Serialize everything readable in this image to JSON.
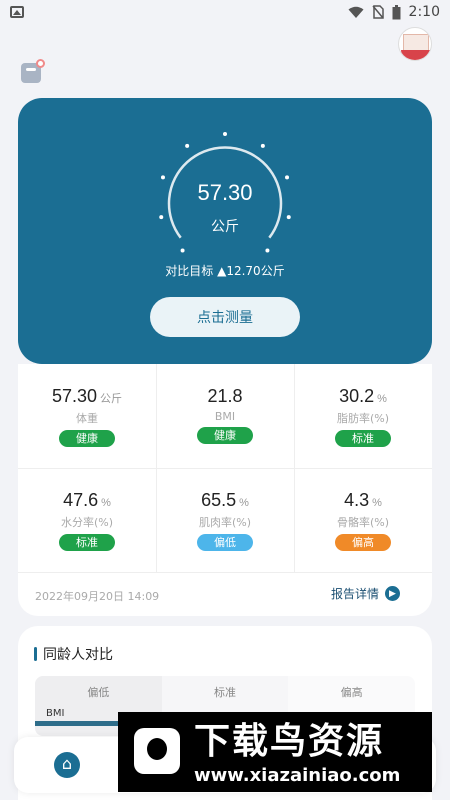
{
  "status_bar": {
    "time": "2:10",
    "icons": [
      "image-icon",
      "wifi-icon",
      "no-sim-icon",
      "battery-icon"
    ]
  },
  "header": {
    "avatar_icon": "user-avatar",
    "scale_icon": "scale-icon"
  },
  "hero": {
    "weight": "57.30",
    "unit": "公斤",
    "target_text": "对比目标 ▲12.70公斤",
    "measure_button": "点击测量",
    "background": "#1b6e93"
  },
  "metrics": [
    {
      "value": "57.30",
      "unit": "公斤",
      "label": "体重",
      "tag": "健康",
      "tag_color": "#1fa24a"
    },
    {
      "value": "21.8",
      "unit": "",
      "label": "BMI",
      "tag": "健康",
      "tag_color": "#1fa24a"
    },
    {
      "value": "30.2",
      "unit": "%",
      "label": "脂肪率(%)",
      "tag": "标准",
      "tag_color": "#1fa24a"
    },
    {
      "value": "47.6",
      "unit": "%",
      "label": "水分率(%)",
      "tag": "标准",
      "tag_color": "#1fa24a"
    },
    {
      "value": "65.5",
      "unit": "%",
      "label": "肌肉率(%)",
      "tag": "偏低",
      "tag_color": "#4db5ea"
    },
    {
      "value": "4.3",
      "unit": "%",
      "label": "骨骼率(%)",
      "tag": "偏高",
      "tag_color": "#f08a28"
    }
  ],
  "report": {
    "date": "2022年09月20日 14:09",
    "link": "报告详情"
  },
  "peer": {
    "title": "同龄人对比",
    "columns": [
      "偏低",
      "标准",
      "偏高"
    ],
    "bmi_label": "BMI"
  },
  "tabbar": {
    "home_icon": "home-icon"
  },
  "watermark": {
    "cn": "下载鸟资源",
    "url": "www.xiazainiao.com"
  }
}
